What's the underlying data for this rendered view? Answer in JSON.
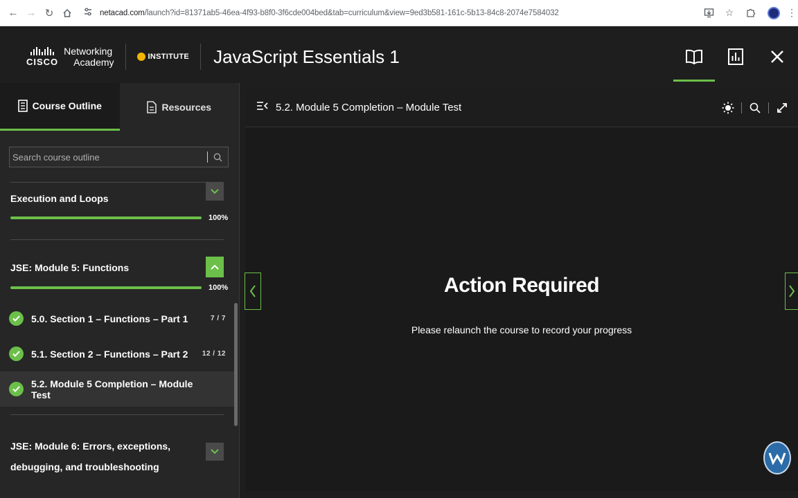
{
  "browser": {
    "url_host": "netacad.com",
    "url_rest": "/launch?id=81371ab5-46ea-4f93-b8f0-3f6cde004bed&tab=curriculum&view=9ed3b581-161c-5b13-84c8-2074e7584032"
  },
  "header": {
    "brand_networking": "Networking",
    "brand_academy": "Academy",
    "brand_cisco": "CISCO",
    "institute": "INSTITUTE",
    "course_title": "JavaScript Essentials 1"
  },
  "sidebar": {
    "tabs": [
      {
        "label": "Course Outline",
        "active": true
      },
      {
        "label": "Resources",
        "active": false
      }
    ],
    "search_placeholder": "Search course outline",
    "modules": [
      {
        "title": "Execution and Loops",
        "progress_pct": "100%",
        "progress": 1.0,
        "expanded": false
      },
      {
        "title": "JSE: Module 5: Functions",
        "progress_pct": "100%",
        "progress": 1.0,
        "expanded": true
      },
      {
        "title_line1": "JSE: Module 6: Errors, exceptions,",
        "title_line2": "debugging, and troubleshooting",
        "expanded": false
      }
    ],
    "lessons": [
      {
        "title": "5.0. Section 1 – Functions – Part 1",
        "count": "7 / 7",
        "completed": true
      },
      {
        "title": "5.1. Section 2 – Functions – Part 2",
        "count": "12 / 12",
        "completed": true
      },
      {
        "title": "5.2. Module 5 Completion – Module Test",
        "count": "",
        "completed": true,
        "current": true
      }
    ]
  },
  "main": {
    "title": "5.2. Module 5 Completion – Module Test",
    "action_title": "Action Required",
    "action_message": "Please relaunch the course to record your progress"
  },
  "colors": {
    "accent": "#6cc04a",
    "background": "#1e1e1e"
  }
}
